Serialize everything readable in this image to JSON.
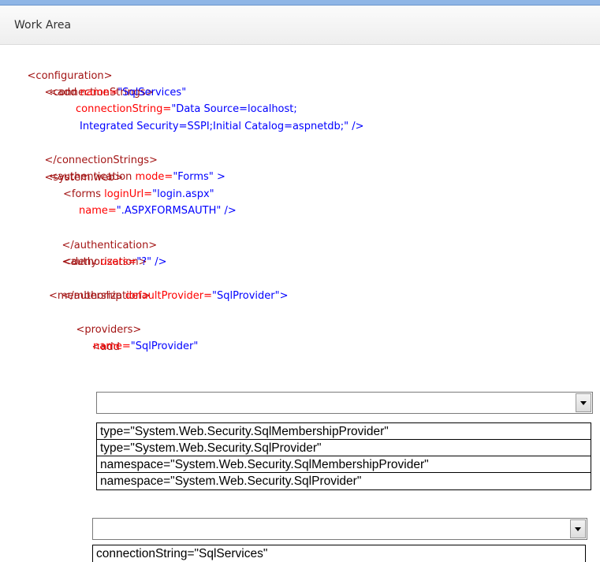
{
  "header": {
    "title": "Work Area"
  },
  "code": {
    "l1_tag": "<configuration>",
    "l2_tag": "<connectionStrings>",
    "l3_tag": "<add",
    "l3_attr": "name=",
    "l3_val": "\"SqlServices\"",
    "l4_attr": "connectionString=",
    "l4_val": "\"Data Source=localhost;",
    "l5_val": "Integrated Security=SSPI;Initial Catalog=aspnetdb;\"",
    "l5_close": "/>",
    "l6_tag": "</connectionStrings>",
    "l7_tag": "<system.web>",
    "l8_tag": "<authentication",
    "l8_attr": "mode=",
    "l8_val": "\"Forms\"",
    "l8_close": ">",
    "l9_tag": "<forms",
    "l9_attr": "loginUrl=",
    "l9_val": "\"login.aspx\"",
    "l10_attr": "name=",
    "l10_val": "\".ASPXFORMSAUTH\"",
    "l10_close": "/>",
    "l11_tag": "</authentication>",
    "l12_tag": "<authorization>",
    "l13_tag": "<deny",
    "l13_attr": "users=",
    "l13_val": "\"?\"",
    "l13_close": "/>",
    "l14_tag": "</authorization>",
    "l15_tag": "<membership",
    "l15_attr": "defaultProvider=",
    "l15_val": "\"SqlProvider\"",
    "l15_close": ">",
    "l16_tag": "<providers>",
    "l17_tag": "<add",
    "l18_attr": "name=",
    "l18_val": "\"SqlProvider\""
  },
  "dropdown1": {
    "selected": "",
    "options": [
      "type=\"System.Web.Security.SqlMembershipProvider\"",
      "type=\"System.Web.Security.SqlProvider\"",
      "namespace=\"System.Web.Security.SqlMembershipProvider\"",
      "namespace=\"System.Web.Security.SqlProvider\""
    ]
  },
  "dropdown2": {
    "selected": "",
    "options": [
      "connectionString=\"SqlServices\""
    ]
  }
}
